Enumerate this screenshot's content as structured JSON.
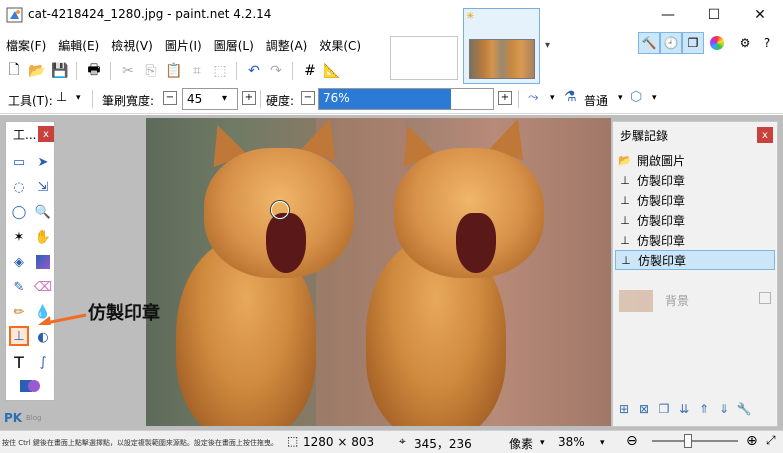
{
  "window": {
    "title": "cat-4218424_1280.jpg - paint.net 4.2.14",
    "minimize": "—",
    "maximize": "☐",
    "close": "✕"
  },
  "menu": [
    "檔案(F)",
    "編輯(E)",
    "檢視(V)",
    "圖片(I)",
    "圖層(L)",
    "調整(A)",
    "效果(C)"
  ],
  "tool_options": {
    "tool_label": "工具(T):",
    "brush_width_label": "筆刷寬度:",
    "brush_width_value": "45",
    "hardness_label": "硬度:",
    "hardness_value": "76%",
    "hardness_fraction": 0.76,
    "blend_mode": "普通"
  },
  "tools_panel": {
    "title": "工...",
    "close": "x"
  },
  "annotation": {
    "label": "仿製印章"
  },
  "history_panel": {
    "title": "步驟記錄",
    "close": "x",
    "items": [
      "開啟圖片",
      "仿製印章",
      "仿製印章",
      "仿製印章",
      "仿製印章",
      "仿製印章"
    ],
    "selected_index": 5,
    "ghost_layer_label": "背景"
  },
  "status": {
    "hint": "按住 Ctrl 鍵後在畫面上點擊選擇點，以設定複製範圍來源點。設定後在畫面上按住拖曳。",
    "image_size": "1280 × 803",
    "cursor_pos": "345，236",
    "units": "像素",
    "zoom": "38%"
  },
  "logo": {
    "text": "PK",
    "sub": "Blog"
  },
  "colors": {
    "accent": "#2b7bd6",
    "highlight": "#f26d21",
    "close_red": "#c8413c"
  }
}
